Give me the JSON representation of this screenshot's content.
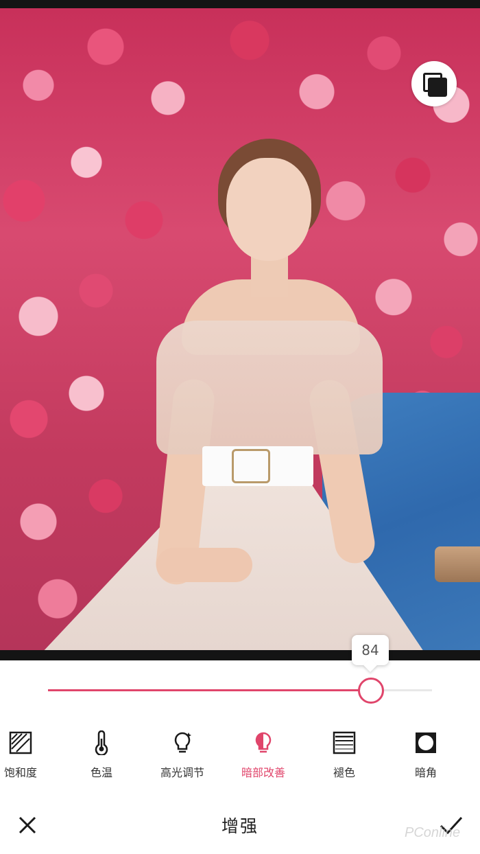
{
  "editor": {
    "title": "增强",
    "slider_value": 84,
    "slider_value_label": "84"
  },
  "tools": [
    {
      "label": "饱和度",
      "icon": "saturation-icon",
      "active": false
    },
    {
      "label": "色温",
      "icon": "thermometer-icon",
      "active": false
    },
    {
      "label": "高光调节",
      "icon": "bulb-sparkle-icon",
      "active": false
    },
    {
      "label": "暗部改善",
      "icon": "bulb-half-icon",
      "active": true
    },
    {
      "label": "褪色",
      "icon": "fade-lines-icon",
      "active": false
    },
    {
      "label": "暗角",
      "icon": "vignette-icon",
      "active": false
    }
  ],
  "watermark": "PConline",
  "colors": {
    "accent": "#e0456b",
    "text": "#333333",
    "background": "#ffffff"
  }
}
